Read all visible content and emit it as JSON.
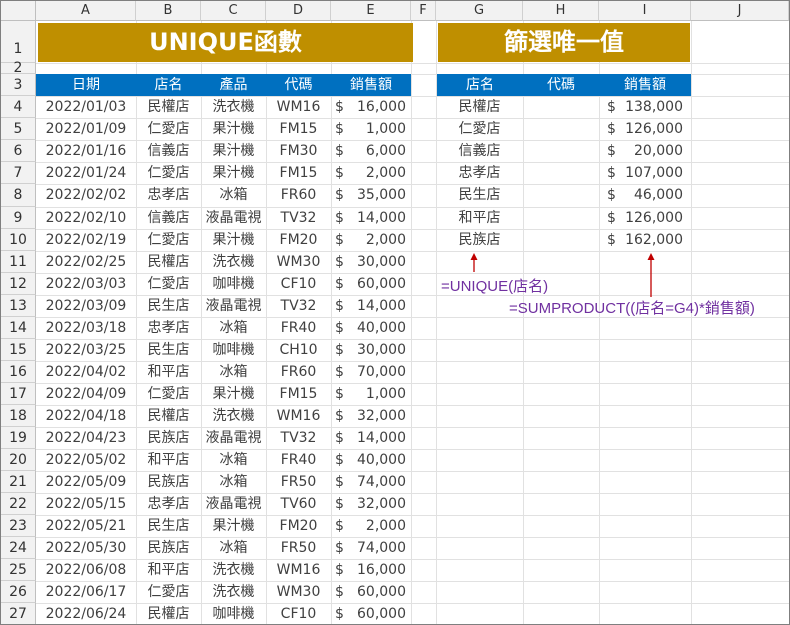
{
  "columns": [
    "A",
    "B",
    "C",
    "D",
    "E",
    "F",
    "G",
    "H",
    "I",
    "J"
  ],
  "rows": [
    "1",
    "2",
    "3",
    "4",
    "5",
    "6",
    "7",
    "8",
    "9",
    "10",
    "11",
    "12",
    "13",
    "14",
    "15",
    "16",
    "17",
    "18",
    "19",
    "20",
    "21",
    "22",
    "23",
    "24",
    "25",
    "26",
    "27"
  ],
  "left_title": "UNIQUE函數",
  "right_title": "篩選唯一值",
  "left_headers": [
    "日期",
    "店名",
    "產品",
    "代碼",
    "銷售額"
  ],
  "right_headers": [
    "店名",
    "代碼",
    "銷售額"
  ],
  "currency_symbol": "$",
  "sales": [
    [
      "2022/01/03",
      "民權店",
      "洗衣機",
      "WM16",
      "16,000"
    ],
    [
      "2022/01/09",
      "仁愛店",
      "果汁機",
      "FM15",
      "1,000"
    ],
    [
      "2022/01/16",
      "信義店",
      "果汁機",
      "FM30",
      "6,000"
    ],
    [
      "2022/01/24",
      "仁愛店",
      "果汁機",
      "FM15",
      "2,000"
    ],
    [
      "2022/02/02",
      "忠孝店",
      "冰箱",
      "FR60",
      "35,000"
    ],
    [
      "2022/02/10",
      "信義店",
      "液晶電視",
      "TV32",
      "14,000"
    ],
    [
      "2022/02/19",
      "仁愛店",
      "果汁機",
      "FM20",
      "2,000"
    ],
    [
      "2022/02/25",
      "民權店",
      "洗衣機",
      "WM30",
      "30,000"
    ],
    [
      "2022/03/03",
      "仁愛店",
      "咖啡機",
      "CF10",
      "60,000"
    ],
    [
      "2022/03/09",
      "民生店",
      "液晶電視",
      "TV32",
      "14,000"
    ],
    [
      "2022/03/18",
      "忠孝店",
      "冰箱",
      "FR40",
      "40,000"
    ],
    [
      "2022/03/25",
      "民生店",
      "咖啡機",
      "CH10",
      "30,000"
    ],
    [
      "2022/04/02",
      "和平店",
      "冰箱",
      "FR60",
      "70,000"
    ],
    [
      "2022/04/09",
      "仁愛店",
      "果汁機",
      "FM15",
      "1,000"
    ],
    [
      "2022/04/18",
      "民權店",
      "洗衣機",
      "WM16",
      "32,000"
    ],
    [
      "2022/04/23",
      "民族店",
      "液晶電視",
      "TV32",
      "14,000"
    ],
    [
      "2022/05/02",
      "和平店",
      "冰箱",
      "FR40",
      "40,000"
    ],
    [
      "2022/05/09",
      "民族店",
      "冰箱",
      "FR50",
      "74,000"
    ],
    [
      "2022/05/15",
      "忠孝店",
      "液晶電視",
      "TV60",
      "32,000"
    ],
    [
      "2022/05/21",
      "民生店",
      "果汁機",
      "FM20",
      "2,000"
    ],
    [
      "2022/05/30",
      "民族店",
      "冰箱",
      "FR50",
      "74,000"
    ],
    [
      "2022/06/08",
      "和平店",
      "洗衣機",
      "WM16",
      "16,000"
    ],
    [
      "2022/06/17",
      "仁愛店",
      "洗衣機",
      "WM30",
      "60,000"
    ],
    [
      "2022/06/24",
      "民權店",
      "咖啡機",
      "CF10",
      "60,000"
    ]
  ],
  "unique_stores": [
    [
      "民權店",
      "",
      "138,000"
    ],
    [
      "仁愛店",
      "",
      "126,000"
    ],
    [
      "信義店",
      "",
      "20,000"
    ],
    [
      "忠孝店",
      "",
      "107,000"
    ],
    [
      "民生店",
      "",
      "46,000"
    ],
    [
      "和平店",
      "",
      "126,000"
    ],
    [
      "民族店",
      "",
      "162,000"
    ]
  ],
  "formula_unique": "=UNIQUE(店名)",
  "formula_sumproduct": "=SUMPRODUCT((店名=G4)*銷售額)",
  "colors": {
    "title_bg": "#bf8f00",
    "header_bg": "#0070c0",
    "formula": "#7030a0",
    "arrow": "#c00000"
  }
}
